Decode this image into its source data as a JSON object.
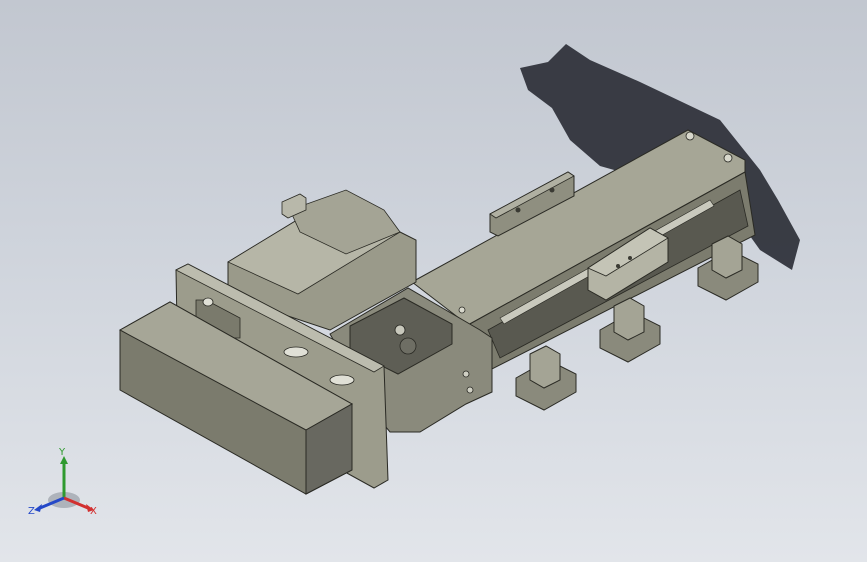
{
  "viewport": {
    "background_top": "#c2c7d0",
    "background_bottom": "#e2e5ea",
    "model_color": "#9c9c8c",
    "shadow_color": "#2c2f37"
  },
  "triad": {
    "x_label": "X",
    "y_label": "Y",
    "z_label": "Z",
    "x_color": "#d23030",
    "y_color": "#2f9a2f",
    "z_color": "#2448c8"
  }
}
